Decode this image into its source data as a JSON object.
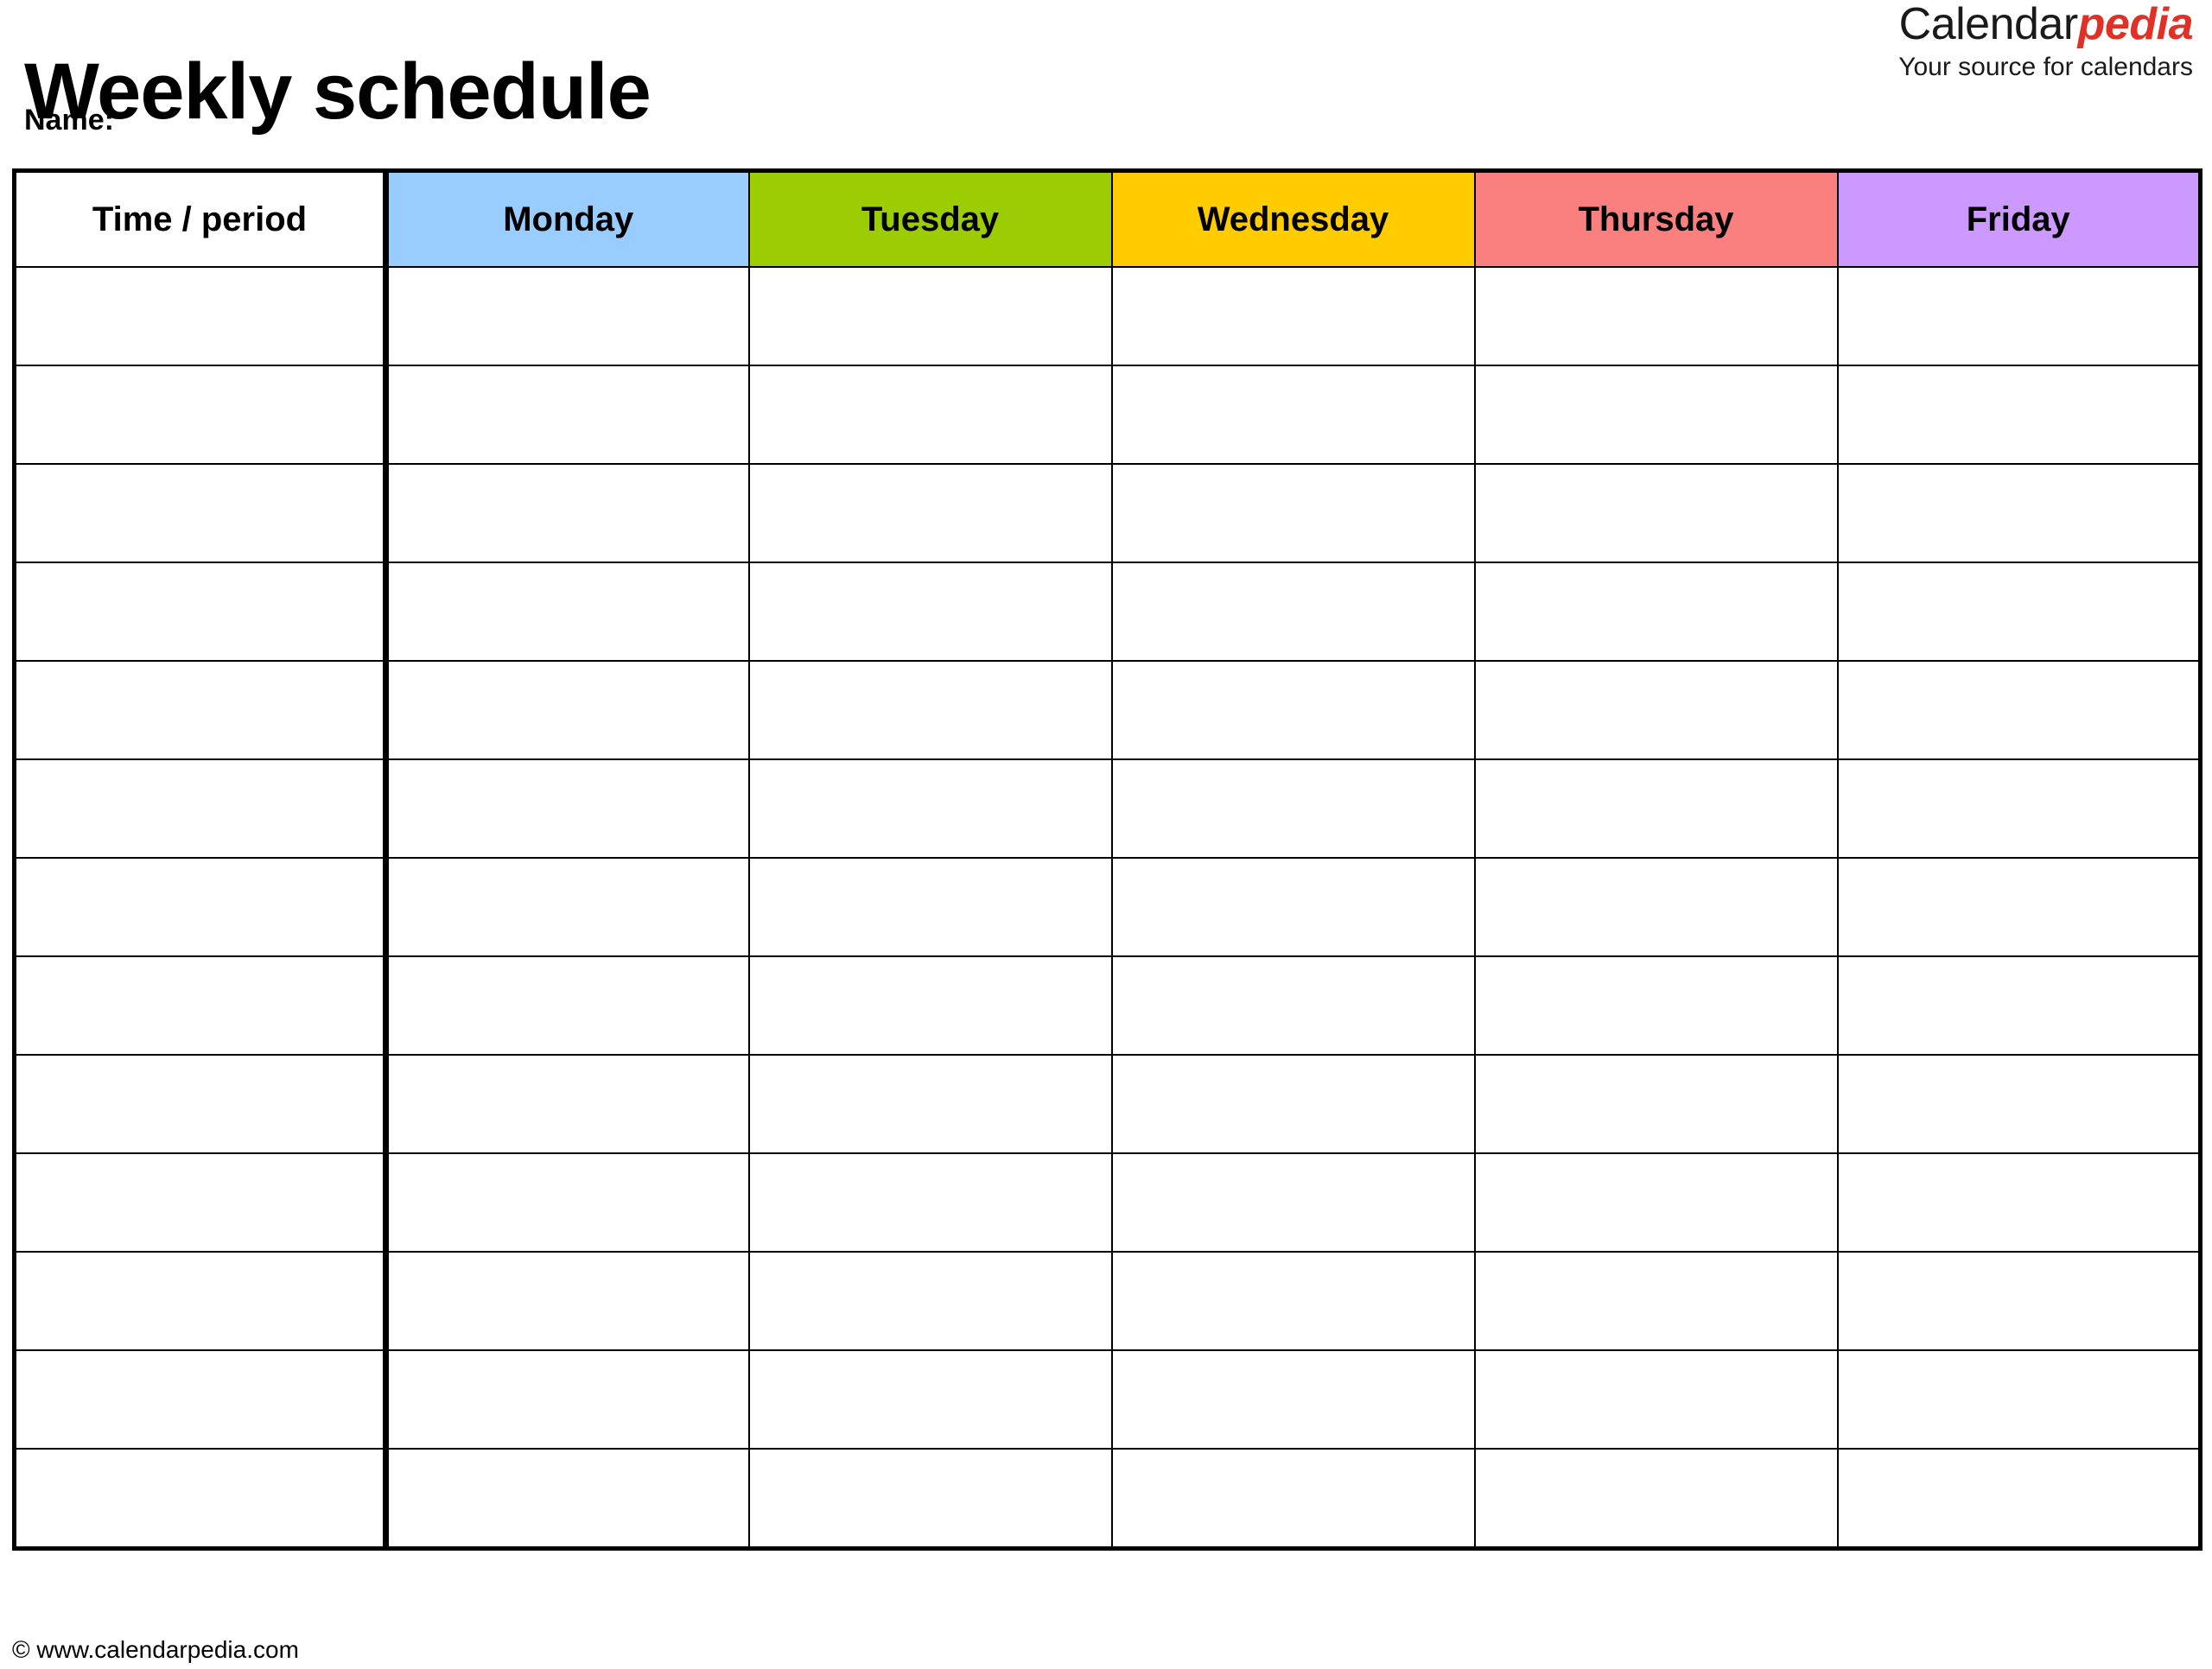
{
  "document": {
    "title": "Weekly schedule",
    "name_label": "Name:"
  },
  "brand": {
    "word_primary": "Calendar",
    "word_accent": "pedia",
    "tagline": "Your source for calendars",
    "accent_color": "#e03127",
    "primary_color": "#1a1a1a"
  },
  "table": {
    "columns": [
      {
        "key": "time",
        "label": "Time / period",
        "bg": "#ffffff"
      },
      {
        "key": "monday",
        "label": "Monday",
        "bg": "#99ccff"
      },
      {
        "key": "tuesday",
        "label": "Tuesday",
        "bg": "#9bcd02"
      },
      {
        "key": "wednesday",
        "label": "Wednesday",
        "bg": "#ffcc00"
      },
      {
        "key": "thursday",
        "label": "Thursday",
        "bg": "#fa7f7f"
      },
      {
        "key": "friday",
        "label": "Friday",
        "bg": "#cc99ff"
      }
    ],
    "row_count": 13,
    "rows": [
      {
        "time": "",
        "monday": "",
        "tuesday": "",
        "wednesday": "",
        "thursday": "",
        "friday": ""
      },
      {
        "time": "",
        "monday": "",
        "tuesday": "",
        "wednesday": "",
        "thursday": "",
        "friday": ""
      },
      {
        "time": "",
        "monday": "",
        "tuesday": "",
        "wednesday": "",
        "thursday": "",
        "friday": ""
      },
      {
        "time": "",
        "monday": "",
        "tuesday": "",
        "wednesday": "",
        "thursday": "",
        "friday": ""
      },
      {
        "time": "",
        "monday": "",
        "tuesday": "",
        "wednesday": "",
        "thursday": "",
        "friday": ""
      },
      {
        "time": "",
        "monday": "",
        "tuesday": "",
        "wednesday": "",
        "thursday": "",
        "friday": ""
      },
      {
        "time": "",
        "monday": "",
        "tuesday": "",
        "wednesday": "",
        "thursday": "",
        "friday": ""
      },
      {
        "time": "",
        "monday": "",
        "tuesday": "",
        "wednesday": "",
        "thursday": "",
        "friday": ""
      },
      {
        "time": "",
        "monday": "",
        "tuesday": "",
        "wednesday": "",
        "thursday": "",
        "friday": ""
      },
      {
        "time": "",
        "monday": "",
        "tuesday": "",
        "wednesday": "",
        "thursday": "",
        "friday": ""
      },
      {
        "time": "",
        "monday": "",
        "tuesday": "",
        "wednesday": "",
        "thursday": "",
        "friday": ""
      },
      {
        "time": "",
        "monday": "",
        "tuesday": "",
        "wednesday": "",
        "thursday": "",
        "friday": ""
      },
      {
        "time": "",
        "monday": "",
        "tuesday": "",
        "wednesday": "",
        "thursday": "",
        "friday": ""
      }
    ]
  },
  "footer": {
    "copyright": "© www.calendarpedia.com"
  }
}
